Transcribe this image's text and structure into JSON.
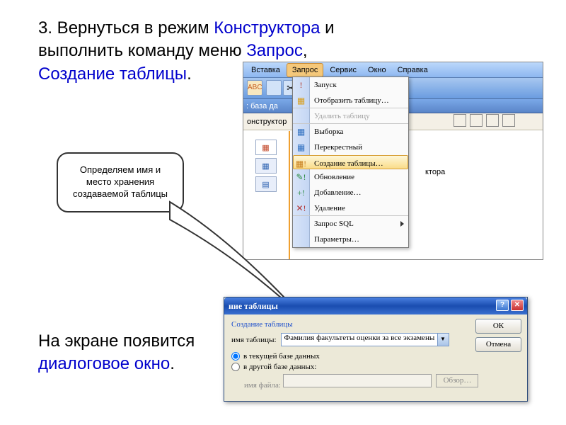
{
  "text": {
    "line1a": "3. Вернуться в режим ",
    "line1b": "Конструктора",
    "line1c": " и",
    "line2a": "выполнить команду меню ",
    "line2b": "Запрос",
    "line2c": ",",
    "line3": "Создание таблицы",
    "line3b": ".",
    "bottom1": "На экране появится",
    "bottom2": "диалоговое окно",
    "bottom2b": "."
  },
  "callout": {
    "text": "Определяем имя и место хранения создаваемой таблицы"
  },
  "menubar": {
    "items": [
      "Вставка",
      "Запрос",
      "Сервис",
      "Окно",
      "Справка"
    ],
    "activeIndex": 1
  },
  "db": {
    "title": ": база да",
    "toolbar_item": "онструктор",
    "rightLabel": "ктора"
  },
  "dropdown": {
    "items": [
      {
        "label": "Запуск",
        "sep": false
      },
      {
        "label": "Отобразить таблицу…",
        "sep": true
      },
      {
        "label": "Удалить таблицу",
        "disabled": true,
        "sep": true
      },
      {
        "label": "Выборка",
        "sep": false
      },
      {
        "label": "Перекрестный",
        "sep": false
      },
      {
        "label": "Создание таблицы…",
        "hover": true,
        "sep": false
      },
      {
        "label": "Обновление",
        "sep": false
      },
      {
        "label": "Добавление…",
        "sep": false
      },
      {
        "label": "Удаление",
        "sep": true
      },
      {
        "label": "Запрос SQL",
        "arrow": true,
        "sep": false
      },
      {
        "label": "Параметры…",
        "sep": false
      }
    ]
  },
  "dialog": {
    "title": "ние таблицы",
    "heading": "Создание таблицы",
    "lbl_name": "имя таблицы:",
    "name_value": "Фамилия факультеты оценки за все экзамены",
    "radio1": "в текущей базе данных",
    "radio2": "в другой базе данных:",
    "lbl_file": "имя файла:",
    "btn_browse": "Обзор…",
    "btn_ok": "ОК",
    "btn_cancel": "Отмена"
  }
}
